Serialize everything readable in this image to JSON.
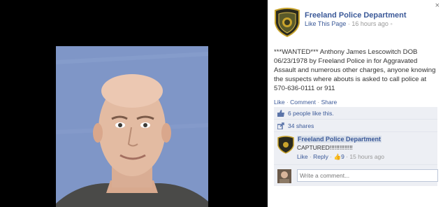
{
  "post": {
    "page_name": "Freeland Police Department",
    "like_page": "Like This Page",
    "timestamp": "16 hours ago",
    "text": "***WANTED*** Anthony James Lescowitch DOB 06/23/1978 by Freeland Police in for Aggravated Assault and numerous other charges, anyone knowing the suspects where abouts is asked to call police at 570-636-0111 or 911",
    "actions": {
      "like": "Like",
      "comment": "Comment",
      "share": "Share"
    }
  },
  "stats": {
    "likes": "6 people like this.",
    "shares": "34 shares"
  },
  "comment": {
    "author": "Freeland Police Department",
    "text": "CAPTURED!!!!!!!!!!!!!!",
    "like": "Like",
    "reply": "Reply",
    "like_count": "9",
    "timestamp": "15 hours ago"
  },
  "composer": {
    "placeholder": "Write a comment..."
  },
  "close_label": "×",
  "colors": {
    "link": "#3b5998",
    "ufi_bg": "#edeff4",
    "photo_bg": "#7f96c7"
  }
}
